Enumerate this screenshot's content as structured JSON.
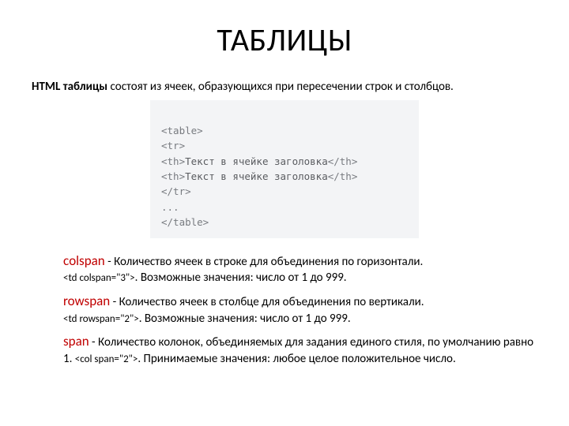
{
  "title": "ТАБЛИЦЫ",
  "intro": {
    "bold": "HTML таблицы",
    "rest": " состоят из ячеек, образующихся при пересечении строк и столбцов."
  },
  "codeLines": [
    {
      "tag": "<table>",
      "text": ""
    },
    {
      "tag": "<tr>",
      "text": ""
    },
    {
      "tag": "<th>",
      "text": "Текст в ячейке заголовка",
      "close": "</th>"
    },
    {
      "tag": "<th>",
      "text": "Текст в ячейке заголовка",
      "close": "</th>"
    },
    {
      "tag": "</tr>",
      "text": ""
    },
    {
      "tag": "...",
      "text": ""
    },
    {
      "tag": "</table>",
      "text": ""
    }
  ],
  "attrs": [
    {
      "name": "сolspan",
      "sep": " - ",
      "desc": "Количество ячеек в строке для объединения по горизонтали.",
      "example": "<td colspan=\"3\">",
      "exampleSep": ". ",
      "values": "Возможные значения: число от 1 до 999."
    },
    {
      "name": "rowspan",
      "sep": "  - ",
      "desc": "Количество ячеек в столбце для объединения по вертикали.",
      "example": "<td rowspan=\"2\">",
      "exampleSep": ". ",
      "values": "Возможные значения: число от 1 до 999."
    },
    {
      "name": "span",
      "sep": " - ",
      "desc": "Количество колонок, объединяемых для задания единого стиля, по умолчанию равно 1. ",
      "example": "<col span=\"2\">",
      "exampleSep": ". ",
      "values": "Принимаемые значения: любое целое положительное число."
    }
  ]
}
